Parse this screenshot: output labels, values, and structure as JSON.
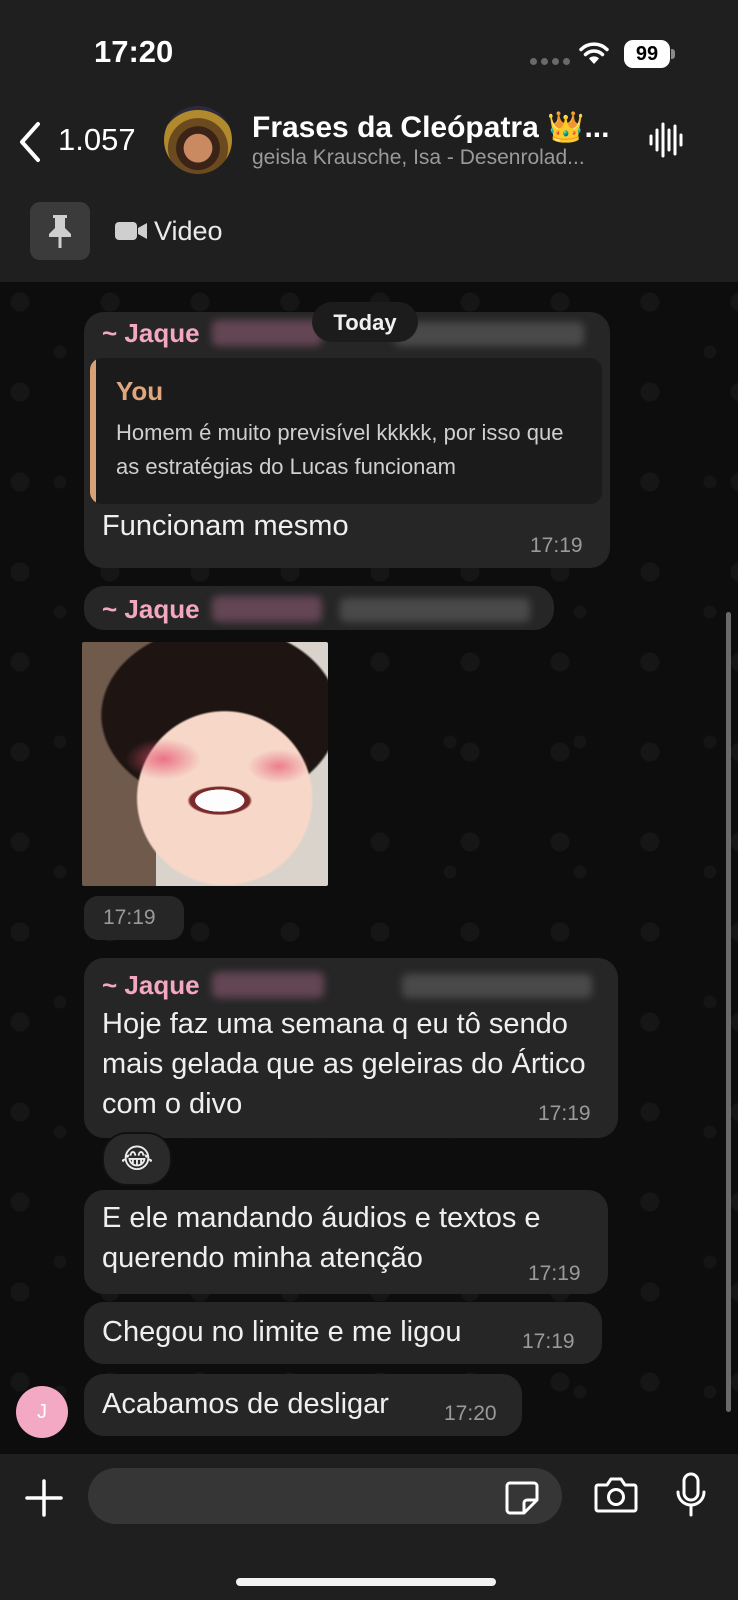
{
  "status_bar": {
    "time": "17:20",
    "battery": "99"
  },
  "header": {
    "back_count": "1.057",
    "title": "Frases da Cleópatra 👑...",
    "members": "geisla Krausche, Isa - Desenrolad...",
    "pinned_label": "Video"
  },
  "chat": {
    "date_divider": "Today",
    "messages": [
      {
        "sender": "~ Jaque",
        "quote_author": "You",
        "quote_text": "Homem é muito previsível kkkkk, por isso que as estratégias do Lucas funcionam",
        "text": "Funcionam mesmo",
        "time": "17:19"
      },
      {
        "sender": "~ Jaque",
        "type": "sticker",
        "time": "17:19"
      },
      {
        "sender": "~ Jaque",
        "text": "Hoje faz uma semana q eu tô sendo mais gelada que as geleiras do Ártico com o divo",
        "time": "17:19",
        "reaction": "😂"
      },
      {
        "text": "E ele mandando áudios e textos e querendo minha atenção",
        "time": "17:19"
      },
      {
        "text": "Chegou no limite e me ligou",
        "time": "17:19"
      },
      {
        "text": "Acabamos de desligar",
        "time": "17:20"
      }
    ],
    "avatar_initial": "J"
  },
  "composer": {
    "placeholder": ""
  },
  "colors": {
    "sender_name": "#f4a7c0",
    "quote_accent": "#d8a279",
    "bubble_bg": "#262626",
    "header_bg": "#1f1f1f"
  }
}
